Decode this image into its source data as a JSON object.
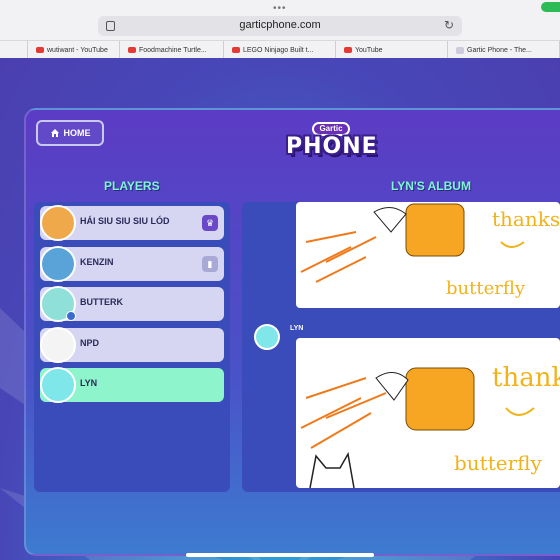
{
  "browser": {
    "url": "garticphone.com",
    "tabs": [
      {
        "label": "wutiwant - YouTube",
        "icon": "youtube-icon"
      },
      {
        "label": "Foodmachine Turtle...",
        "icon": "youtube-icon"
      },
      {
        "label": "LEGO Ninjago Built t...",
        "icon": "youtube-icon"
      },
      {
        "label": "YouTube",
        "icon": "youtube-icon"
      },
      {
        "label": "Gartic Phone - The...",
        "icon": "garticphone-icon"
      }
    ]
  },
  "header": {
    "home_label": "HOME",
    "logo_top": "Gartic",
    "logo_main": "PHONE"
  },
  "players": {
    "title": "PLAYERS",
    "items": [
      {
        "name": "HÁI SIU SIU SIU LÓD",
        "badge": "crown-icon",
        "active": false
      },
      {
        "name": "KENZIN",
        "badge": "stats-icon",
        "active": false
      },
      {
        "name": "BUTTERK",
        "badge": "",
        "active": false
      },
      {
        "name": "NPD",
        "badge": "",
        "active": false
      },
      {
        "name": "LYN",
        "badge": "",
        "active": true
      }
    ]
  },
  "album": {
    "title": "LYN'S ALBUM",
    "author_label": "LYN",
    "drawing_text_1": "thanks",
    "drawing_text_2": "butterfly"
  },
  "colors": {
    "accent_title": "#7ff7d4",
    "active_player": "#8ef4cc",
    "player_row": "#d6d6f2",
    "panel_bg": "#3a4cba"
  }
}
